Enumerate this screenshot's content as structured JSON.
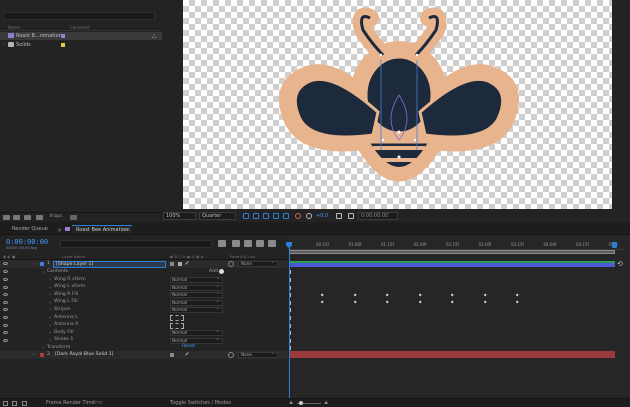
{
  "project": {
    "columns": {
      "name": "Name",
      "comment": "Comment"
    },
    "items": [
      {
        "name": "Roast B...nimation",
        "swatch": "#9c7bd9"
      },
      {
        "name": "Solids",
        "swatch": "#e6c84a"
      }
    ]
  },
  "viewer": {
    "zoom": "100%",
    "resolution": "Quarter",
    "exposure": "+0.0",
    "timecode": "0:00:00:00"
  },
  "tabs": {
    "render_queue": "Render Queue",
    "comp": "Roast Bee Animation"
  },
  "timeline": {
    "timecode": "0:00:00:00",
    "fps": "00000 (30.00 fps)",
    "columns": {
      "layer_name": "Layer Name",
      "parent_link": "Parent & Link"
    },
    "ruler": [
      "00:15f",
      "01:00f",
      "01:15f",
      "02:00f",
      "02:15f",
      "03:00f",
      "03:15f",
      "04:00f",
      "04:15f",
      "05:0"
    ],
    "layer1": {
      "num": "1",
      "name": "[Shape Layer 1]",
      "parent": "None",
      "color": "#3f7fd8"
    },
    "contents_label": "Contents",
    "add_label": "Add",
    "props": [
      {
        "label": "Wing R xform",
        "mode": "Normal",
        "keys": false
      },
      {
        "label": "Wing L xform",
        "mode": "Normal",
        "keys": false
      },
      {
        "label": "Wing R Fill",
        "mode": "Normal",
        "keys": true
      },
      {
        "label": "Wing L Fill",
        "mode": "Normal",
        "keys": true
      },
      {
        "label": "Stripes",
        "mode": "Normal",
        "keys": false
      },
      {
        "label": "Antenna L",
        "mode": "",
        "keys": false
      },
      {
        "label": "Antenna R",
        "mode": "",
        "keys": false
      },
      {
        "label": "Body Fill",
        "mode": "Normal",
        "keys": false
      },
      {
        "label": "Stroke 1",
        "mode": "Normal",
        "keys": false
      }
    ],
    "transform_label": "Transform",
    "reset_label": "Reset",
    "layer2": {
      "num": "2",
      "name": "[Dark Royal Blue Solid 1]",
      "parent": "None",
      "color": "#b53a3a"
    }
  },
  "bottom": {
    "frame_render": "Frame Render Time",
    "frame_render_val": "2ms",
    "toggle": "Toggle Switches / Modes"
  },
  "colors": {
    "accent": "#2a7fd6",
    "timecode": "#3e9bff",
    "bee_outline": "#e8b48e",
    "bee_fill": "#1c2a3c",
    "track_green": "#2e9a5a",
    "track_blue": "#4a5bd6",
    "track_red": "#9a3a3a"
  }
}
